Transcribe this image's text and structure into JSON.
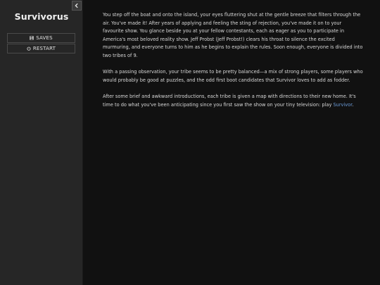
{
  "sidebar": {
    "title": "Survivorus",
    "menu": {
      "saves_label": "SAVES",
      "restart_label": "RESTART"
    }
  },
  "passage": {
    "p1": "You step off the boat and onto the island, your eyes fluttering shut at the gentle breeze that filters through the air. You've made it! After years of applying and feeling the sting of rejection, you've made it on to your favourite show. You glance beside you at your fellow contestants, each as eager as you to participate in America's most beloved reality show. Jeff Probst (Jeff Probst!) clears his throat to silence the excited murmuring, and everyone turns to him as he begins to explain the rules. Soon enough, everyone is divided into two tribes of 9.",
    "p2": "With a passing observation, your tribe seems to be pretty balanced—a mix of strong players, some players who would probably be good at puzzles, and the odd first boot candidates that Survivor loves to add as fodder.",
    "p3_before": "After some brief and awkward introductions, each tribe is given a map with directions to their new home. It's time to do what you've been anticipating since you first saw the show on your tiny television: play ",
    "p3_link": "Survivor",
    "p3_after": "."
  },
  "colors": {
    "sidebar_bg": "#262626",
    "main_bg": "#111111",
    "link": "#6b9bd8"
  },
  "icons": {
    "collapse": "chevron-left-icon",
    "saves": "floppy-disk-icon",
    "restart": "power-icon"
  }
}
